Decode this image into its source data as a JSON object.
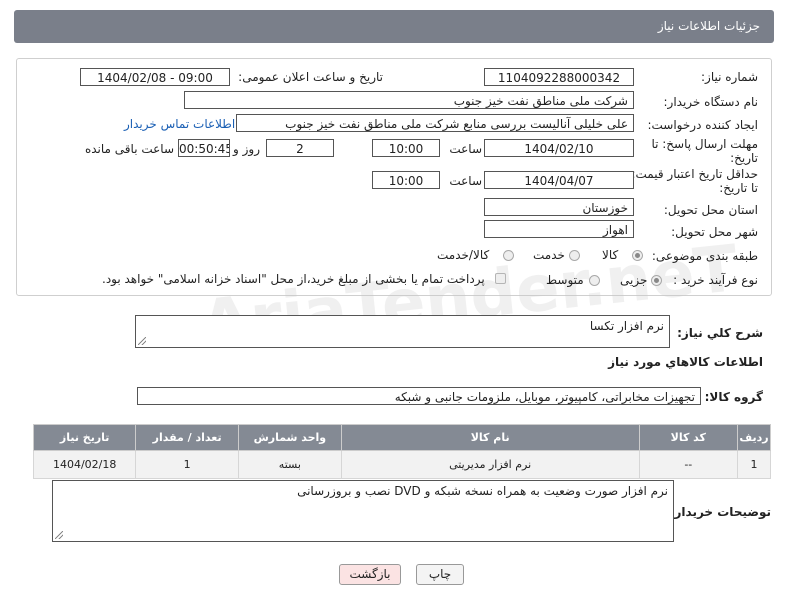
{
  "header": {
    "title": "جزئیات اطلاعات نیاز"
  },
  "form": {
    "need_number": {
      "label": "شماره نیاز:",
      "value": "1104092288000342"
    },
    "announce_datetime": {
      "label": "تاریخ و ساعت اعلان عمومی:",
      "value": "1404/02/08 - 09:00"
    },
    "buyer_org": {
      "label": "نام دستگاه خریدار:",
      "value": "شرکت ملی مناطق نفت خیز جنوب"
    },
    "requester": {
      "label": "ایجاد کننده درخواست:",
      "value": "علی  خلیلی  آنالیست بررسی منابع شرکت ملی مناطق نفت خیز جنوب",
      "contact_link": "اطلاعات تماس خریدار"
    },
    "reply_deadline": {
      "label_line1": "مهلت ارسال پاسخ: تا",
      "label_line2": "تاریخ:",
      "date": "1404/02/10",
      "time_label": "ساعت",
      "time": "10:00",
      "days": "2",
      "days_label": "روز و",
      "remaining": "00:50:45",
      "remaining_label": "ساعت باقی مانده"
    },
    "price_validity": {
      "label_line1": "حداقل تاریخ اعتبار قیمت:",
      "label_line2": "تا تاریخ:",
      "date": "1404/04/07",
      "time_label": "ساعت",
      "time": "10:00"
    },
    "delivery_province": {
      "label": "استان محل تحویل:",
      "value": "خوزستان"
    },
    "delivery_city": {
      "label": "شهر محل تحویل:",
      "value": "اهواز"
    },
    "category": {
      "label": "طبقه بندی موضوعی:",
      "options": [
        "کالا",
        "خدمت",
        "کالا/خدمت"
      ],
      "selected": "کالا"
    },
    "purchase_type": {
      "label": "نوع فرآیند خرید :",
      "options": [
        "جزیی",
        "متوسط"
      ],
      "selected": "جزیی",
      "payment_note": "پرداخت تمام یا بخشی از مبلغ خرید،از محل \"اسناد خزانه اسلامی\" خواهد بود."
    }
  },
  "summary": {
    "label": "شرح کلي نياز:",
    "value": "نرم افزار تکسا"
  },
  "goods_info": {
    "title": "اطلاعات کالاهاي مورد نياز",
    "group_label": "گروه کالا:",
    "group_value": "تجهیزات مخابراتی، کامپیوتر، موبایل، ملزومات جانبی و شبکه",
    "table": {
      "headers": [
        "ردیف",
        "کد کالا",
        "نام کالا",
        "واحد شمارش",
        "تعداد / مقدار",
        "تاریخ نیاز"
      ],
      "rows": [
        [
          "1",
          "--",
          "نرم افزار مدیریتی",
          "بسته",
          "1",
          "1404/02/18"
        ]
      ]
    }
  },
  "buyer_notes": {
    "label": "توضیحات خریدار:",
    "value": "نرم افزار صورت وضعیت به همراه نسخه شبکه و DVD نصب و بروزرسانی"
  },
  "buttons": {
    "print": "چاپ",
    "back": "بازگشت"
  },
  "watermark": "AriaTender.neT"
}
